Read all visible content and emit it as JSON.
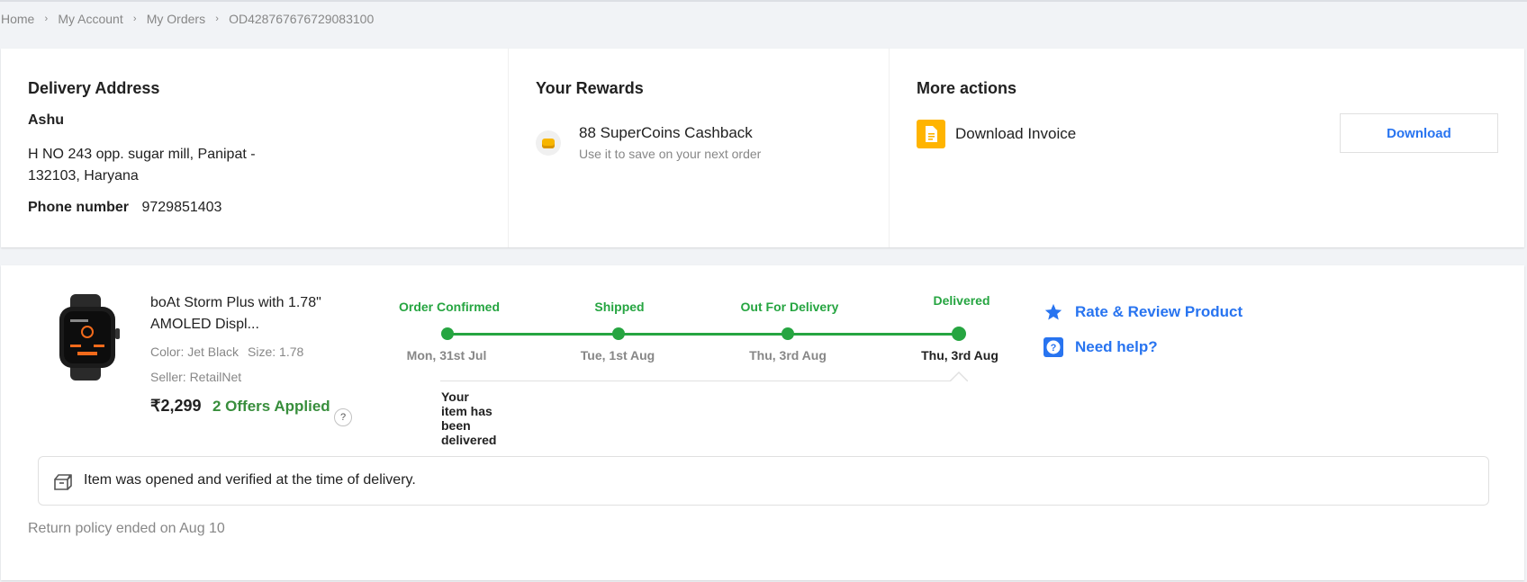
{
  "breadcrumb": {
    "items": [
      "Home",
      "My Account",
      "My Orders",
      "OD428767676729083100"
    ],
    "separator": "›"
  },
  "delivery": {
    "heading": "Delivery Address",
    "name": "Ashu",
    "address": "H NO 243 opp. sugar mill, Panipat - 132103, Haryana",
    "phone_label": "Phone number",
    "phone": "9729851403"
  },
  "rewards": {
    "heading": "Your Rewards",
    "title": "88 SuperCoins Cashback",
    "subtitle": "Use it to save on your next order",
    "icon": "supercoin-icon"
  },
  "more_actions": {
    "heading": "More actions",
    "invoice_label": "Download Invoice",
    "download_button": "Download",
    "icon": "document-icon"
  },
  "product": {
    "name": "boAt Storm Plus with 1.78\" AMOLED Displ...",
    "color_label": "Color: Jet Black",
    "size_label": "Size: 1.78",
    "seller": "Seller: RetailNet",
    "price": "₹2,299",
    "offers": "2 Offers Applied",
    "offers_help": "?"
  },
  "tracking": {
    "steps": [
      {
        "label": "Order Confirmed",
        "date": "Mon, 31st Jul"
      },
      {
        "label": "Shipped",
        "date": "Tue, 1st Aug"
      },
      {
        "label": "Out For Delivery",
        "date": "Thu, 3rd Aug"
      },
      {
        "label": "Delivered",
        "date": "Thu, 3rd Aug"
      }
    ],
    "message": "Your item has been delivered",
    "accent": "#26a541"
  },
  "actions": {
    "rate": "Rate & Review Product",
    "help": "Need help?",
    "accent": "#2874f0"
  },
  "verification": {
    "text": "Item was opened and verified at the time of delivery.",
    "icon": "open-box-icon"
  },
  "policy": "Return policy ended on Aug 10"
}
